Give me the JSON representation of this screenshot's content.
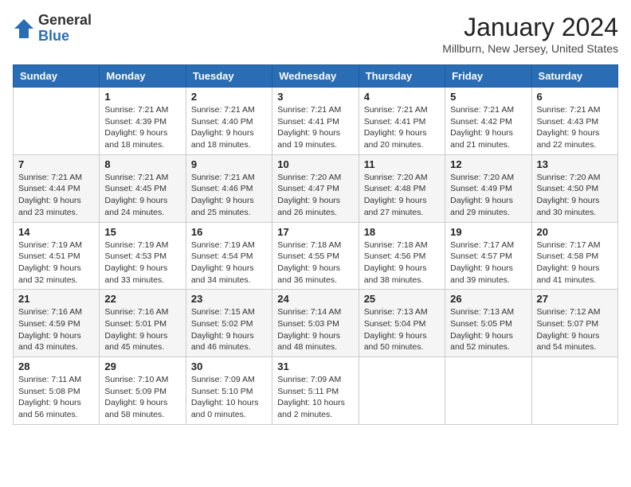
{
  "header": {
    "logo_general": "General",
    "logo_blue": "Blue",
    "month_title": "January 2024",
    "location": "Millburn, New Jersey, United States"
  },
  "days_of_week": [
    "Sunday",
    "Monday",
    "Tuesday",
    "Wednesday",
    "Thursday",
    "Friday",
    "Saturday"
  ],
  "weeks": [
    [
      {
        "day": "",
        "info": ""
      },
      {
        "day": "1",
        "info": "Sunrise: 7:21 AM\nSunset: 4:39 PM\nDaylight: 9 hours\nand 18 minutes."
      },
      {
        "day": "2",
        "info": "Sunrise: 7:21 AM\nSunset: 4:40 PM\nDaylight: 9 hours\nand 18 minutes."
      },
      {
        "day": "3",
        "info": "Sunrise: 7:21 AM\nSunset: 4:41 PM\nDaylight: 9 hours\nand 19 minutes."
      },
      {
        "day": "4",
        "info": "Sunrise: 7:21 AM\nSunset: 4:41 PM\nDaylight: 9 hours\nand 20 minutes."
      },
      {
        "day": "5",
        "info": "Sunrise: 7:21 AM\nSunset: 4:42 PM\nDaylight: 9 hours\nand 21 minutes."
      },
      {
        "day": "6",
        "info": "Sunrise: 7:21 AM\nSunset: 4:43 PM\nDaylight: 9 hours\nand 22 minutes."
      }
    ],
    [
      {
        "day": "7",
        "info": "Sunrise: 7:21 AM\nSunset: 4:44 PM\nDaylight: 9 hours\nand 23 minutes."
      },
      {
        "day": "8",
        "info": "Sunrise: 7:21 AM\nSunset: 4:45 PM\nDaylight: 9 hours\nand 24 minutes."
      },
      {
        "day": "9",
        "info": "Sunrise: 7:21 AM\nSunset: 4:46 PM\nDaylight: 9 hours\nand 25 minutes."
      },
      {
        "day": "10",
        "info": "Sunrise: 7:20 AM\nSunset: 4:47 PM\nDaylight: 9 hours\nand 26 minutes."
      },
      {
        "day": "11",
        "info": "Sunrise: 7:20 AM\nSunset: 4:48 PM\nDaylight: 9 hours\nand 27 minutes."
      },
      {
        "day": "12",
        "info": "Sunrise: 7:20 AM\nSunset: 4:49 PM\nDaylight: 9 hours\nand 29 minutes."
      },
      {
        "day": "13",
        "info": "Sunrise: 7:20 AM\nSunset: 4:50 PM\nDaylight: 9 hours\nand 30 minutes."
      }
    ],
    [
      {
        "day": "14",
        "info": "Sunrise: 7:19 AM\nSunset: 4:51 PM\nDaylight: 9 hours\nand 32 minutes."
      },
      {
        "day": "15",
        "info": "Sunrise: 7:19 AM\nSunset: 4:53 PM\nDaylight: 9 hours\nand 33 minutes."
      },
      {
        "day": "16",
        "info": "Sunrise: 7:19 AM\nSunset: 4:54 PM\nDaylight: 9 hours\nand 34 minutes."
      },
      {
        "day": "17",
        "info": "Sunrise: 7:18 AM\nSunset: 4:55 PM\nDaylight: 9 hours\nand 36 minutes."
      },
      {
        "day": "18",
        "info": "Sunrise: 7:18 AM\nSunset: 4:56 PM\nDaylight: 9 hours\nand 38 minutes."
      },
      {
        "day": "19",
        "info": "Sunrise: 7:17 AM\nSunset: 4:57 PM\nDaylight: 9 hours\nand 39 minutes."
      },
      {
        "day": "20",
        "info": "Sunrise: 7:17 AM\nSunset: 4:58 PM\nDaylight: 9 hours\nand 41 minutes."
      }
    ],
    [
      {
        "day": "21",
        "info": "Sunrise: 7:16 AM\nSunset: 4:59 PM\nDaylight: 9 hours\nand 43 minutes."
      },
      {
        "day": "22",
        "info": "Sunrise: 7:16 AM\nSunset: 5:01 PM\nDaylight: 9 hours\nand 45 minutes."
      },
      {
        "day": "23",
        "info": "Sunrise: 7:15 AM\nSunset: 5:02 PM\nDaylight: 9 hours\nand 46 minutes."
      },
      {
        "day": "24",
        "info": "Sunrise: 7:14 AM\nSunset: 5:03 PM\nDaylight: 9 hours\nand 48 minutes."
      },
      {
        "day": "25",
        "info": "Sunrise: 7:13 AM\nSunset: 5:04 PM\nDaylight: 9 hours\nand 50 minutes."
      },
      {
        "day": "26",
        "info": "Sunrise: 7:13 AM\nSunset: 5:05 PM\nDaylight: 9 hours\nand 52 minutes."
      },
      {
        "day": "27",
        "info": "Sunrise: 7:12 AM\nSunset: 5:07 PM\nDaylight: 9 hours\nand 54 minutes."
      }
    ],
    [
      {
        "day": "28",
        "info": "Sunrise: 7:11 AM\nSunset: 5:08 PM\nDaylight: 9 hours\nand 56 minutes."
      },
      {
        "day": "29",
        "info": "Sunrise: 7:10 AM\nSunset: 5:09 PM\nDaylight: 9 hours\nand 58 minutes."
      },
      {
        "day": "30",
        "info": "Sunrise: 7:09 AM\nSunset: 5:10 PM\nDaylight: 10 hours\nand 0 minutes."
      },
      {
        "day": "31",
        "info": "Sunrise: 7:09 AM\nSunset: 5:11 PM\nDaylight: 10 hours\nand 2 minutes."
      },
      {
        "day": "",
        "info": ""
      },
      {
        "day": "",
        "info": ""
      },
      {
        "day": "",
        "info": ""
      }
    ]
  ]
}
